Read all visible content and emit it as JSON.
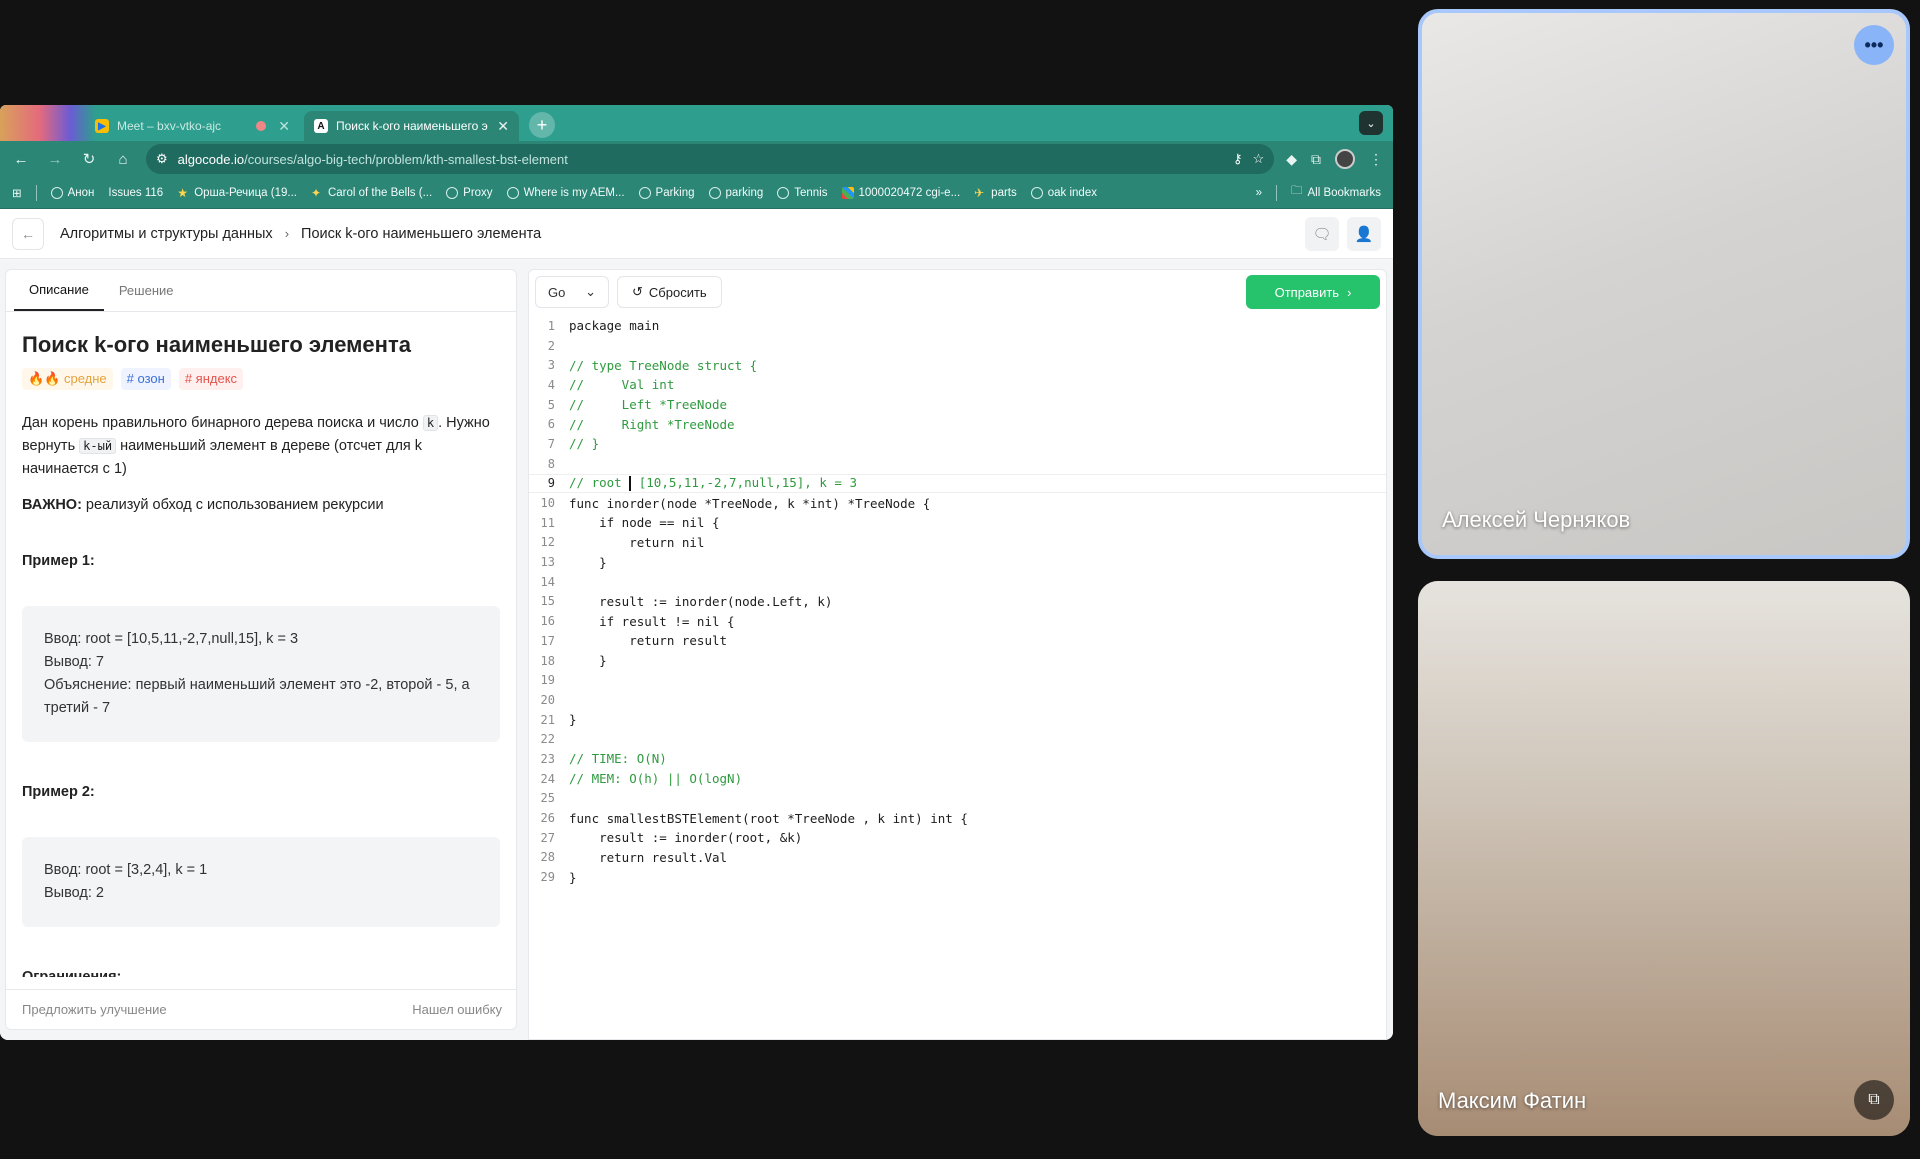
{
  "browser": {
    "tabs": [
      {
        "title": "Meet – bxv-vtko-ajc",
        "favicon": "meet-icon"
      },
      {
        "title": "Поиск k-ого наименьшего э",
        "favicon": "A"
      }
    ],
    "url_host": "algocode.io",
    "url_path": "/courses/algo-big-tech/problem/kth-smallest-bst-element",
    "bookmarks": [
      "Анон",
      "Issues 116",
      "Орша-Речица (19...",
      "Carol of the Bells (...",
      "Proxy",
      "Where is my AEM...",
      "Parking",
      "parking",
      "Tennis",
      "1000020472 cgi-e...",
      "parts",
      "oak index"
    ],
    "more_bookmarks": "»",
    "all_bookmarks": "All Bookmarks"
  },
  "page": {
    "breadcrumb_parent": "Алгоритмы и структуры данных",
    "breadcrumb_sep": "›",
    "breadcrumb_current": "Поиск k-ого наименьшего элемента"
  },
  "problem": {
    "tab_description": "Описание",
    "tab_solution": "Решение",
    "title": "Поиск k-ого наименьшего элемента",
    "difficulty": "🔥🔥 средне",
    "tag1": "# озон",
    "tag2": "# яндекс",
    "desc_1": "Дан корень правильного бинарного дерева поиска и число ",
    "desc_k": "k",
    "desc_2": ". Нужно вернуть ",
    "desc_kth": "k-ый",
    "desc_3": " наименьший элемент в дереве (отсчет для k начинается с 1)",
    "important_label": "ВАЖНО:",
    "important_text": " реализуй обход с использованием рекурсии",
    "example1_title": "Пример 1:",
    "example1_input": "Ввод: root = [10,5,11,-2,7,null,15], k = 3",
    "example1_output": "Вывод: 7",
    "example1_explain": "Объяснение: первый наименьший элемент это -2, второй - 5, а третий - 7",
    "example2_title": "Пример 2:",
    "example2_input": "Ввод: root = [3,2,4], k = 1",
    "example2_output": "Вывод: 2",
    "constraints_title": "Ограничения:",
    "suggest": "Предложить улучшение",
    "found_error": "Нашел ошибку"
  },
  "editor": {
    "language": "Go",
    "reset_label": "Сбросить",
    "submit_label": "Отправить",
    "current_line": 9,
    "lines": [
      "package main",
      "",
      "// type TreeNode struct {",
      "//     Val int",
      "//     Left *TreeNode",
      "//     Right *TreeNode",
      "// }",
      "",
      "// root = [10,5,11,-2,7,null,15], k = 3",
      "func inorder(node *TreeNode, k *int) *TreeNode {",
      "    if node == nil {",
      "        return nil",
      "    }",
      "",
      "    result := inorder(node.Left, k)",
      "    if result != nil {",
      "        return result",
      "    }",
      "",
      "",
      "}",
      "",
      "// TIME: O(N)",
      "// MEM: O(h) || O(logN)",
      "",
      "func smallestBSTElement(root *TreeNode , k int) int {",
      "    result := inorder(root, &k)",
      "    return result.Val",
      "}"
    ]
  },
  "meet": {
    "participant1": "Алексей Черняков",
    "participant2": "Максим Фатин",
    "accent": "#a8c7fa"
  }
}
